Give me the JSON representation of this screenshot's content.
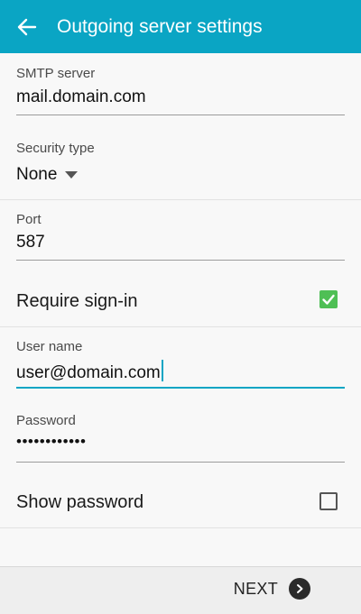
{
  "header": {
    "title": "Outgoing server settings",
    "back_icon": "arrow-back-icon",
    "background_color": "#0aa5c4"
  },
  "smtp_server": {
    "label": "SMTP server",
    "value": "mail.domain.com"
  },
  "security_type": {
    "label": "Security type",
    "value": "None",
    "icon": "dropdown-arrow-icon"
  },
  "port": {
    "label": "Port",
    "value": "587"
  },
  "require_signin": {
    "label": "Require sign-in",
    "checked": true,
    "check_color": "#4fbf55"
  },
  "username": {
    "label": "User name",
    "value": "user@domain.com",
    "focused": true
  },
  "password": {
    "label": "Password",
    "value": "••••••••••••"
  },
  "show_password": {
    "label": "Show password",
    "checked": false
  },
  "footer": {
    "next_label": "NEXT",
    "next_icon": "chevron-right-circle-icon"
  }
}
